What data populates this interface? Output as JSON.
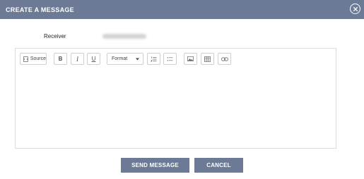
{
  "dialog": {
    "title": "CREATE A MESSAGE",
    "close_icon": "close-circle-icon"
  },
  "receiver": {
    "label": "Receiver",
    "value_note": ""
  },
  "toolbar": {
    "source_label": "Source",
    "bold_label": "B",
    "italic_label": "I",
    "underline_label": "U",
    "format_label": "Format",
    "icons": [
      "source-icon",
      "bold-icon",
      "italic-icon",
      "underline-icon",
      "format-dropdown-icon",
      "ordered-list-icon",
      "bulleted-list-icon",
      "image-icon",
      "table-icon",
      "link-icon"
    ]
  },
  "actions": {
    "send_label": "SEND MESSAGE",
    "cancel_label": "CANCEL"
  },
  "colors": {
    "header_bg": "#6c7a96",
    "button_bg": "#6c7a96"
  }
}
